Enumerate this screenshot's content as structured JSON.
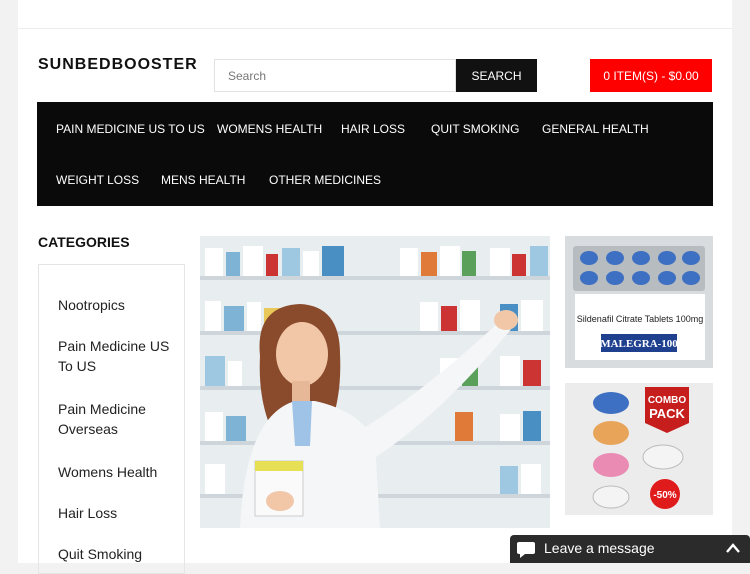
{
  "header": {
    "logo": "SUNBEDBOOSTER",
    "search": {
      "placeholder": "Search",
      "button_label": "SEARCH"
    },
    "cart_label": "0 ITEM(S) - $0.00"
  },
  "nav": {
    "items": [
      "PAIN MEDICINE US TO US",
      "WOMENS HEALTH",
      "HAIR LOSS",
      "QUIT SMOKING",
      "GENERAL HEALTH",
      "WEIGHT LOSS",
      "MENS HEALTH",
      "OTHER MEDICINES"
    ]
  },
  "categories": {
    "title": "CATEGORIES",
    "items": [
      "Nootropics",
      "Pain Medicine US To US",
      "Pain Medicine Overseas",
      "Womens Health",
      "Hair Loss",
      "Quit Smoking"
    ]
  },
  "promo1": {
    "line1": "Sildenafil Citrate Tablets 100mg",
    "line2": "MALEGRA-100"
  },
  "promo2": {
    "badge_line1": "COMBO",
    "badge_line2": "PACK",
    "discount": "-50%"
  },
  "chat": {
    "label": "Leave a message",
    "icon": "chat-bubble-icon",
    "toggle_icon": "chevron-up-icon"
  },
  "colors": {
    "accent": "#ff0000",
    "nav_bg": "#0a0a0a",
    "chat_bg": "#2b2b2b"
  }
}
